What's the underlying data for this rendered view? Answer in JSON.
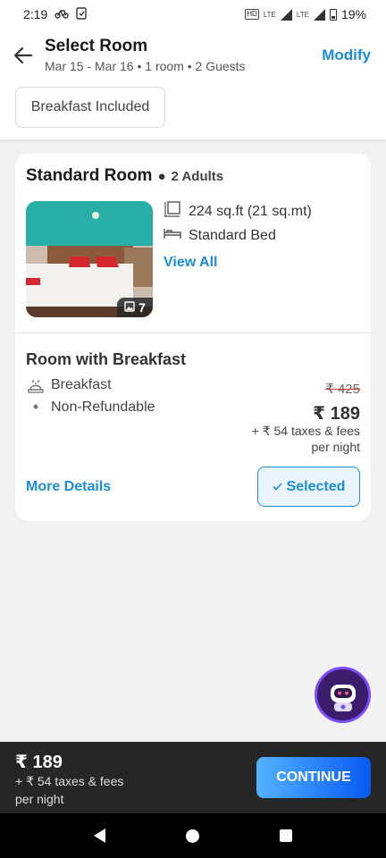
{
  "status_bar": {
    "time": "2:19",
    "hd_label": "HD",
    "network1": "LTE",
    "network2": "LTE",
    "battery": "19%"
  },
  "header": {
    "title": "Select Room",
    "subtitle": "Mar 15 - Mar 16 • 1 room • 2 Guests",
    "modify_label": "Modify"
  },
  "filters": {
    "chip_label": "Breakfast Included"
  },
  "room": {
    "name": "Standard Room",
    "occupancy": "2 Adults",
    "photo_count": "7",
    "area": "224 sq.ft (21 sq.mt)",
    "bed": "Standard Bed",
    "view_all_label": "View All"
  },
  "plan": {
    "title": "Room with Breakfast",
    "inclusions": [
      "Breakfast",
      "Non-Refundable"
    ],
    "original_price": "₹ 425",
    "price": "₹ 189",
    "taxes": "+ ₹ 54 taxes & fees",
    "per_night": "per night",
    "more_details_label": "More Details",
    "selected_label": "Selected"
  },
  "bottom_bar": {
    "price": "₹ 189",
    "taxes": "+ ₹ 54 taxes & fees",
    "per_night": "per night",
    "continue_label": "CONTINUE"
  },
  "colors": {
    "accent": "#1a8ddb",
    "bottom_bar_bg": "#262626",
    "continue_gradient_start": "#53b2fe",
    "continue_gradient_end": "#065af3",
    "strike_red": "#d9302c"
  }
}
